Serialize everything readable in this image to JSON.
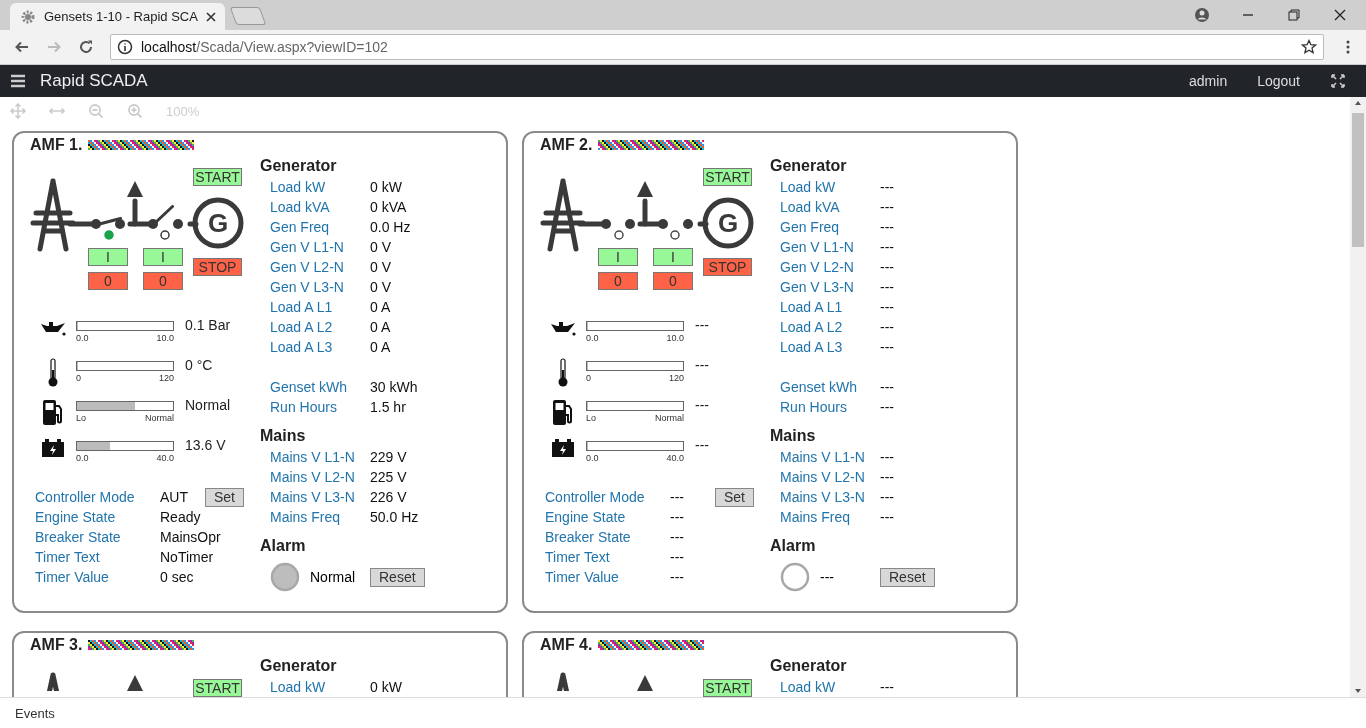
{
  "browser": {
    "tab_title": "Gensets 1-10 - Rapid SCA",
    "url_host": "localhost",
    "url_path": "/Scada/View.aspx?viewID=102"
  },
  "app": {
    "title": "Rapid SCADA",
    "user": "admin",
    "logout": "Logout"
  },
  "toolbar": {
    "zoom": "100%"
  },
  "cards": [
    {
      "title": "AMF 1.",
      "start": "START",
      "stop": "STOP",
      "generator_symbol": "G",
      "breakers": [
        {
          "closed": true,
          "open": false,
          "on": "I",
          "off": "0"
        },
        {
          "closed": false,
          "open": true,
          "on": "I",
          "off": "0"
        }
      ],
      "gauges": [
        {
          "kind": "oil",
          "level": 0.01,
          "min": "0.0",
          "max": "10.0",
          "reading": "0.1 Bar"
        },
        {
          "kind": "temperature",
          "level": 0,
          "min": "0",
          "max": "120",
          "reading": "0 °C"
        },
        {
          "kind": "fuel",
          "level": 0.6,
          "min": "Lo",
          "max": "Normal",
          "reading": "Normal"
        },
        {
          "kind": "battery",
          "level": 0.34,
          "min": "0.0",
          "max": "40.0",
          "reading": "13.6 V"
        }
      ],
      "status": [
        {
          "label": "Controller Mode",
          "value": "AUT",
          "button": "Set"
        },
        {
          "label": "Engine State",
          "value": "Ready"
        },
        {
          "label": "Breaker State",
          "value": "MainsOpr"
        },
        {
          "label": "Timer Text",
          "value": "NoTimer"
        },
        {
          "label": "Timer Value",
          "value": "0 sec"
        }
      ],
      "generator": {
        "heading": "Generator",
        "rows": [
          {
            "label": "Load kW",
            "value": "0 kW"
          },
          {
            "label": "Load kVA",
            "value": "0 kVA"
          },
          {
            "label": "Gen Freq",
            "value": "0.0 Hz"
          },
          {
            "label": "Gen V L1-N",
            "value": "0 V"
          },
          {
            "label": "Gen V L2-N",
            "value": "0 V"
          },
          {
            "label": "Gen V L3-N",
            "value": "0 V"
          },
          {
            "label": "Load A L1",
            "value": "0 A"
          },
          {
            "label": "Load A L2",
            "value": "0 A"
          },
          {
            "label": "Load A L3",
            "value": "0 A"
          }
        ],
        "totals": [
          {
            "label": "Genset kWh",
            "value": "30 kWh"
          },
          {
            "label": "Run Hours",
            "value": "1.5 hr"
          }
        ]
      },
      "mains": {
        "heading": "Mains",
        "rows": [
          {
            "label": "Mains V L1-N",
            "value": "229 V"
          },
          {
            "label": "Mains V L2-N",
            "value": "225 V"
          },
          {
            "label": "Mains V L3-N",
            "value": "226 V"
          },
          {
            "label": "Mains Freq",
            "value": "50.0 Hz"
          }
        ]
      },
      "alarm": {
        "heading": "Alarm",
        "normal": true,
        "text": "Normal",
        "button": "Reset"
      }
    },
    {
      "title": "AMF 2.",
      "start": "START",
      "stop": "STOP",
      "generator_symbol": "G",
      "breakers": [
        {
          "closed": false,
          "open": false,
          "on": "I",
          "off": "0"
        },
        {
          "closed": false,
          "open": false,
          "on": "I",
          "off": "0"
        }
      ],
      "gauges": [
        {
          "kind": "oil",
          "level": 0,
          "min": "0.0",
          "max": "10.0",
          "reading": "---"
        },
        {
          "kind": "temperature",
          "level": 0,
          "min": "0",
          "max": "120",
          "reading": "---"
        },
        {
          "kind": "fuel",
          "level": 0,
          "min": "Lo",
          "max": "Normal",
          "reading": "---"
        },
        {
          "kind": "battery",
          "level": 0,
          "min": "0.0",
          "max": "40.0",
          "reading": "---"
        }
      ],
      "status": [
        {
          "label": "Controller Mode",
          "value": "---",
          "button": "Set"
        },
        {
          "label": "Engine State",
          "value": "---"
        },
        {
          "label": "Breaker State",
          "value": "---"
        },
        {
          "label": "Timer Text",
          "value": "---"
        },
        {
          "label": "Timer Value",
          "value": "---"
        }
      ],
      "generator": {
        "heading": "Generator",
        "rows": [
          {
            "label": "Load kW",
            "value": "---"
          },
          {
            "label": "Load kVA",
            "value": "---"
          },
          {
            "label": "Gen Freq",
            "value": "---"
          },
          {
            "label": "Gen V L1-N",
            "value": "---"
          },
          {
            "label": "Gen V L2-N",
            "value": "---"
          },
          {
            "label": "Gen V L3-N",
            "value": "---"
          },
          {
            "label": "Load A L1",
            "value": "---"
          },
          {
            "label": "Load A L2",
            "value": "---"
          },
          {
            "label": "Load A L3",
            "value": "---"
          }
        ],
        "totals": [
          {
            "label": "Genset kWh",
            "value": "---"
          },
          {
            "label": "Run Hours",
            "value": "---"
          }
        ]
      },
      "mains": {
        "heading": "Mains",
        "rows": [
          {
            "label": "Mains V L1-N",
            "value": "---"
          },
          {
            "label": "Mains V L2-N",
            "value": "---"
          },
          {
            "label": "Mains V L3-N",
            "value": "---"
          },
          {
            "label": "Mains Freq",
            "value": "---"
          }
        ]
      },
      "alarm": {
        "heading": "Alarm",
        "normal": false,
        "text": "---",
        "button": "Reset"
      }
    },
    {
      "title": "AMF 3.",
      "start": "START",
      "generator": {
        "heading": "Generator",
        "rows": [
          {
            "label": "Load kW",
            "value": "0 kW"
          }
        ]
      }
    },
    {
      "title": "AMF 4.",
      "start": "START",
      "generator": {
        "heading": "Generator",
        "rows": [
          {
            "label": "Load kW",
            "value": "---"
          }
        ]
      }
    }
  ],
  "footer": {
    "events": "Events"
  }
}
